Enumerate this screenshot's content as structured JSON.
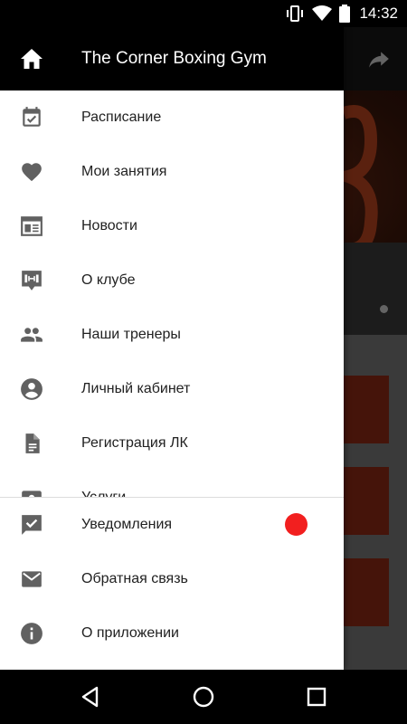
{
  "status_bar": {
    "time": "14:32",
    "icons": [
      "vibrate-icon",
      "wifi-icon",
      "battery-icon"
    ]
  },
  "drawer": {
    "title": "The Corner Boxing Gym",
    "items": [
      {
        "label": "Расписание",
        "icon": "calendar-check-icon"
      },
      {
        "label": "Мои занятия",
        "icon": "heart-icon"
      },
      {
        "label": "Новости",
        "icon": "news-icon"
      },
      {
        "label": "О клубе",
        "icon": "dumbbell-icon"
      },
      {
        "label": "Наши тренеры",
        "icon": "people-icon"
      },
      {
        "label": "Личный кабинет",
        "icon": "account-circle-icon"
      },
      {
        "label": "Регистрация ЛК",
        "icon": "document-icon"
      },
      {
        "label": "Услуги",
        "icon": "services-icon"
      }
    ],
    "bottom_items": [
      {
        "label": "Уведомления",
        "icon": "notification-check-icon",
        "has_badge": true
      },
      {
        "label": "Обратная связь",
        "icon": "mail-icon"
      },
      {
        "label": "О приложении",
        "icon": "info-icon"
      }
    ]
  },
  "colors": {
    "drawer_header": "#000000",
    "icon_gray": "#616161",
    "badge_red": "#f21f1f",
    "accent_card": "#6a2010"
  },
  "nav_bar": {
    "buttons": [
      "back-icon",
      "home-icon",
      "recents-icon"
    ]
  }
}
